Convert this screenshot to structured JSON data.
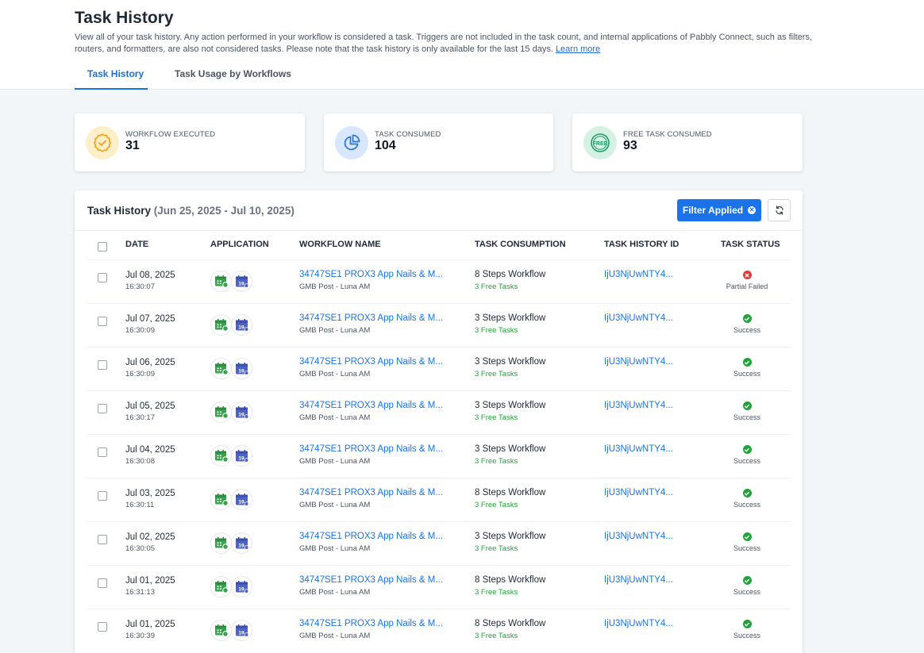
{
  "header": {
    "title": "Task History",
    "description": "View all of your task history. Any action performed in your workflow is considered a task. Triggers are not included in the task count, and internal applications of Pabbly Connect, such as filters, routers, and formatters, are also not considered tasks. Please note that the task history is only available for the last 15 days.",
    "learn_more": "Learn more",
    "tabs": [
      {
        "label": "Task History",
        "active": true
      },
      {
        "label": "Task Usage by Workflows",
        "active": false
      }
    ]
  },
  "stats": [
    {
      "label": "WORKFLOW EXECUTED",
      "value": "31",
      "icon": "badge-check-icon",
      "bg": "#fdefc7",
      "color": "#f0a526"
    },
    {
      "label": "TASK CONSUMED",
      "value": "104",
      "icon": "pie-chart-icon",
      "bg": "#d8e7fb",
      "color": "#2f74d0"
    },
    {
      "label": "FREE TASK CONSUMED",
      "value": "93",
      "icon": "free-badge-icon",
      "bg": "#d4f1e3",
      "color": "#1f9d6b"
    }
  ],
  "panel": {
    "title": "Task History",
    "range": "(Jun 25, 2025 - Jul 10, 2025)",
    "filter_label": "Filter Applied",
    "columns": [
      "DATE",
      "APPLICATION",
      "WORKFLOW NAME",
      "TASK CONSUMPTION",
      "TASK HISTORY ID",
      "TASK STATUS"
    ]
  },
  "rows": [
    {
      "date": "Jul 08, 2025",
      "time": "16:30:07",
      "workflow": "34747SE1 PROX3 App Nails & M...",
      "workflow_sub": "GMB Post - Luna AM",
      "steps": "8 Steps Workflow",
      "free": "3 Free Tasks",
      "id": "IjU3NjUwNTY4...",
      "status": "Partial Failed",
      "ok": false
    },
    {
      "date": "Jul 07, 2025",
      "time": "16:30:09",
      "workflow": "34747SE1 PROX3 App Nails & M...",
      "workflow_sub": "GMB Post - Luna AM",
      "steps": "3 Steps Workflow",
      "free": "3 Free Tasks",
      "id": "IjU3NjUwNTY4...",
      "status": "Success",
      "ok": true
    },
    {
      "date": "Jul 06, 2025",
      "time": "16:30:09",
      "workflow": "34747SE1 PROX3 App Nails & M...",
      "workflow_sub": "GMB Post - Luna AM",
      "steps": "3 Steps Workflow",
      "free": "3 Free Tasks",
      "id": "IjU3NjUwNTY4...",
      "status": "Success",
      "ok": true
    },
    {
      "date": "Jul 05, 2025",
      "time": "16:30:17",
      "workflow": "34747SE1 PROX3 App Nails & M...",
      "workflow_sub": "GMB Post - Luna AM",
      "steps": "3 Steps Workflow",
      "free": "3 Free Tasks",
      "id": "IjU3NjUwNTY4...",
      "status": "Success",
      "ok": true
    },
    {
      "date": "Jul 04, 2025",
      "time": "16:30:08",
      "workflow": "34747SE1 PROX3 App Nails & M...",
      "workflow_sub": "GMB Post - Luna AM",
      "steps": "3 Steps Workflow",
      "free": "3 Free Tasks",
      "id": "IjU3NjUwNTY4...",
      "status": "Success",
      "ok": true
    },
    {
      "date": "Jul 03, 2025",
      "time": "16:30:11",
      "workflow": "34747SE1 PROX3 App Nails & M...",
      "workflow_sub": "GMB Post - Luna AM",
      "steps": "8 Steps Workflow",
      "free": "3 Free Tasks",
      "id": "IjU3NjUwNTY4...",
      "status": "Success",
      "ok": true
    },
    {
      "date": "Jul 02, 2025",
      "time": "16:30:05",
      "workflow": "34747SE1 PROX3 App Nails & M...",
      "workflow_sub": "GMB Post - Luna AM",
      "steps": "3 Steps Workflow",
      "free": "3 Free Tasks",
      "id": "IjU3NjUwNTY4...",
      "status": "Success",
      "ok": true
    },
    {
      "date": "Jul 01, 2025",
      "time": "16:31:13",
      "workflow": "34747SE1 PROX3 App Nails & M...",
      "workflow_sub": "GMB Post - Luna AM",
      "steps": "8 Steps Workflow",
      "free": "3 Free Tasks",
      "id": "IjU3NjUwNTY4...",
      "status": "Success",
      "ok": true
    },
    {
      "date": "Jul 01, 2025",
      "time": "16:30:39",
      "workflow": "34747SE1 PROX3 App Nails & M...",
      "workflow_sub": "GMB Post - Luna AM",
      "steps": "8 Steps Workflow",
      "free": "3 Free Tasks",
      "id": "IjU3NjUwNTY4...",
      "status": "Success",
      "ok": true
    }
  ],
  "colors": {
    "accent": "#1a73e8",
    "success": "#22a33a",
    "failed": "#e03b3b"
  }
}
